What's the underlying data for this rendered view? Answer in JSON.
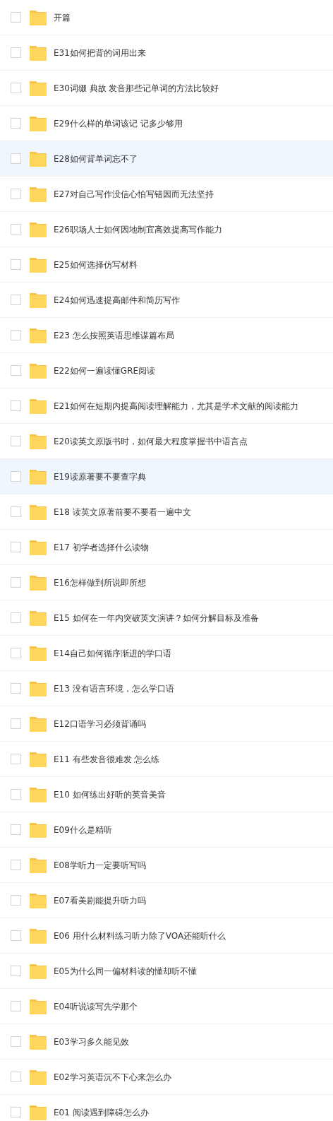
{
  "files": [
    {
      "name": "开篇",
      "checked": false,
      "highlighted": false
    },
    {
      "name": "E31如何把背的词用出来",
      "checked": false,
      "highlighted": false
    },
    {
      "name": "E30词缀 典故 发音那些记单词的方法比较好",
      "checked": false,
      "highlighted": false
    },
    {
      "name": "E29什么样的单词该记 记多少够用",
      "checked": false,
      "highlighted": false
    },
    {
      "name": "E28如何背单词忘不了",
      "checked": false,
      "highlighted": true
    },
    {
      "name": "E27对自己写作没信心怕写错因而无法坚持",
      "checked": false,
      "highlighted": false
    },
    {
      "name": "E26职场人士如何因地制宜高效提高写作能力",
      "checked": false,
      "highlighted": false
    },
    {
      "name": "E25如何选择仿写材料",
      "checked": false,
      "highlighted": false
    },
    {
      "name": "E24如何迅速提高邮件和简历写作",
      "checked": false,
      "highlighted": false
    },
    {
      "name": "E23 怎么按照英语思维谋篇布局",
      "checked": false,
      "highlighted": false
    },
    {
      "name": "E22如何一遍读懂GRE阅读",
      "checked": false,
      "highlighted": false
    },
    {
      "name": "E21如何在短期内提高阅读理解能力，尤其是学术文献的阅读能力",
      "checked": false,
      "highlighted": false
    },
    {
      "name": "E20读英文原版书时，如何最大程度掌握书中语言点",
      "checked": false,
      "highlighted": false
    },
    {
      "name": "E19读原著要不要查字典",
      "checked": false,
      "highlighted": true
    },
    {
      "name": "E18 读英文原著前要不要看一遍中文",
      "checked": false,
      "highlighted": false
    },
    {
      "name": "E17 初学者选择什么读物",
      "checked": false,
      "highlighted": false
    },
    {
      "name": "E16怎样做到所说即所想",
      "checked": false,
      "highlighted": false
    },
    {
      "name": "E15 如何在一年内突破英文演讲？如何分解目标及准备",
      "checked": false,
      "highlighted": false
    },
    {
      "name": "E14自己如何循序渐进的学口语",
      "checked": false,
      "highlighted": false
    },
    {
      "name": "E13 没有语言环境，怎么学口语",
      "checked": false,
      "highlighted": false
    },
    {
      "name": "E12口语学习必须背诵吗",
      "checked": false,
      "highlighted": false
    },
    {
      "name": "E11 有些发音很难发 怎么练",
      "checked": false,
      "highlighted": false
    },
    {
      "name": "E10 如何练出好听的英音美音",
      "checked": false,
      "highlighted": false
    },
    {
      "name": "E09什么是精听",
      "checked": false,
      "highlighted": false
    },
    {
      "name": "E08学听力一定要听写吗",
      "checked": false,
      "highlighted": false
    },
    {
      "name": "E07看美剧能提升听力吗",
      "checked": false,
      "highlighted": false
    },
    {
      "name": "E06 用什么材料练习听力除了VOA还能听什么",
      "checked": false,
      "highlighted": false
    },
    {
      "name": "E05为什么同一偏材料读的懂却听不懂",
      "checked": false,
      "highlighted": false
    },
    {
      "name": "E04听说读写先学那个",
      "checked": false,
      "highlighted": false
    },
    {
      "name": "E03学习多久能见效",
      "checked": false,
      "highlighted": false
    },
    {
      "name": "E02学习英语沉不下心来怎么办",
      "checked": false,
      "highlighted": false
    },
    {
      "name": "E01 阅读遇到障碍怎么办",
      "checked": false,
      "highlighted": false
    }
  ]
}
